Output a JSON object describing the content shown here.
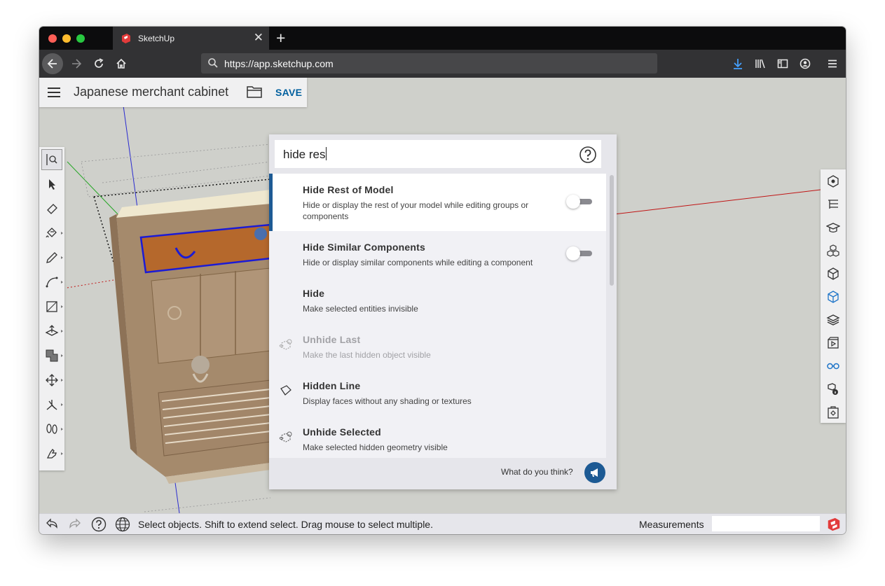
{
  "browser": {
    "tab_title": "SketchUp",
    "url": "https://app.sketchup.com"
  },
  "app": {
    "model_name": "Japanese merchant cabinet",
    "save_label": "SAVE"
  },
  "search": {
    "query": "hide res",
    "results": [
      {
        "title": "Hide Rest of Model",
        "description": "Hide or display the rest of your model while editing groups or components",
        "selected": true,
        "enabled": true,
        "toggle": "off"
      },
      {
        "title": "Hide Similar Components",
        "description": "Hide or display similar components while editing a component",
        "selected": false,
        "enabled": true,
        "toggle": "off"
      },
      {
        "title": "Hide",
        "description": "Make selected entities invisible",
        "selected": false,
        "enabled": true
      },
      {
        "title": "Unhide Last",
        "description": "Make the last hidden object visible",
        "selected": false,
        "enabled": false,
        "icon": "unhide-icon"
      },
      {
        "title": "Hidden Line",
        "description": "Display faces without any shading or textures",
        "selected": false,
        "enabled": true,
        "icon": "hidden-line-icon"
      },
      {
        "title": "Unhide Selected",
        "description": "Make selected hidden geometry visible",
        "selected": false,
        "enabled": true,
        "icon": "unhide-icon"
      }
    ],
    "feedback_label": "What do you think?"
  },
  "statusbar": {
    "hint": "Select objects. Shift to extend select. Drag mouse to select multiple.",
    "measurements_label": "Measurements",
    "measurements_value": ""
  },
  "colors": {
    "accent": "#005f9e",
    "selection_bar": "#1d5a94",
    "canvas": "#cfd0cb"
  }
}
